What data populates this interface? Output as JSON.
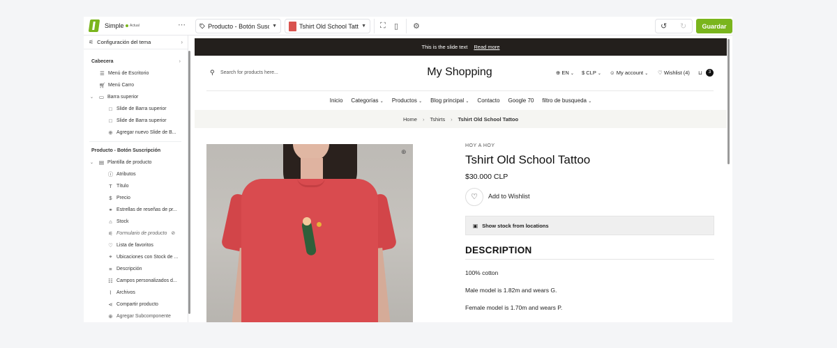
{
  "colors": {
    "brand_green": "#7ab51d",
    "announce_bg": "#231f1c",
    "shirt": "#d94b4f"
  },
  "topbar": {
    "theme_name": "Simple",
    "theme_badge": "Actual",
    "more_icon": "ellipsis-icon",
    "page_select": "Producto - Botón Susc...",
    "product_select": "Tshirt Old School Tattoo",
    "save_label": "Guardar"
  },
  "sidebar": {
    "config_label": "Configuración del tema",
    "section_header": "Cabecera",
    "desktop_menu": "Menú de Escritorio",
    "cart_menu": "Menú Carro",
    "top_bar": "Barra superior",
    "slide1": "Slide de Barra superior",
    "slide2": "Slide de Barra superior",
    "add_slide": "Agregar nuevo Slide de B...",
    "section_product": "Producto - Botón Suscripción",
    "template": "Plantilla de producto",
    "items": [
      "Atributos",
      "Título",
      "Precio",
      "Estrellas de reseñas de pr...",
      "Stock",
      "Formulario de producto",
      "Lista de favoritos",
      "Ubicaciones con Stock de ...",
      "Descripción",
      "Campos personalizados d...",
      "Archivos",
      "Compartir producto",
      "Agregar Subcomponente"
    ]
  },
  "preview": {
    "announce_text": "This is the slide text",
    "announce_link": "Read more",
    "search_placeholder": "Search for products here...",
    "brand": "My Shopping",
    "lang": "EN",
    "currency": "CLP",
    "account": "My account",
    "wishlist": "Wishlist (4)",
    "cart_count": "3",
    "nav": [
      "Inicio",
      "Categorías",
      "Productos",
      "Blog principal",
      "Contacto",
      "Google 70",
      "filtro de busqueda"
    ],
    "breadcrumb": {
      "home": "Home",
      "category": "Tshirts",
      "current": "Tshirt Old School Tattoo"
    },
    "vendor": "HOY A HOY",
    "product_title": "Tshirt Old School Tattoo",
    "price": "$30.000 CLP",
    "wishlist_label": "Add to Wishlist",
    "stock_label": "Show stock from locations",
    "description_heading": "DESCRIPTION",
    "description_lines": [
      "100% cotton",
      "Male model is 1.82m and wears G.",
      "Female model is 1.70m and wears P."
    ]
  }
}
